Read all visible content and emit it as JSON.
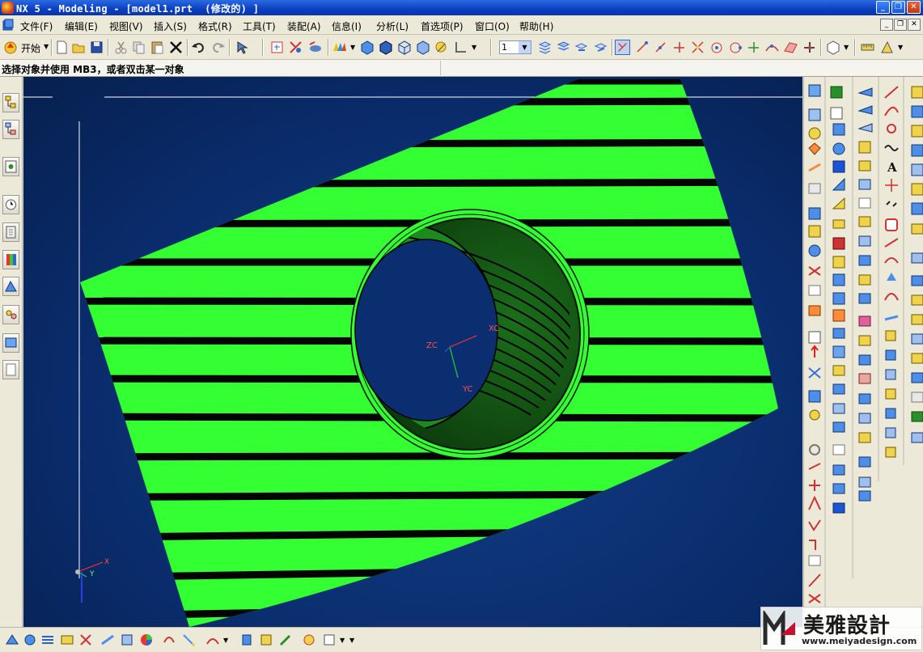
{
  "window": {
    "title": "NX 5 - Modeling - [model1.prt  (修改的) ]",
    "minimize_glyph": "_",
    "restore_glyph": "❐",
    "close_glyph": "✕"
  },
  "menubar": {
    "items": [
      "文件(F)",
      "编辑(E)",
      "视图(V)",
      "插入(S)",
      "格式(R)",
      "工具(T)",
      "装配(A)",
      "信息(I)",
      "分析(L)",
      "首选项(P)",
      "窗口(O)",
      "帮助(H)"
    ],
    "mdi_minimize": "_",
    "mdi_restore": "❐",
    "mdi_close": "✕"
  },
  "toolbar": {
    "start_label": "开始",
    "layer_value": "1"
  },
  "cue_line": {
    "text": "选择对象并使用 MB3，或者双击某一对象"
  },
  "viewport": {
    "wcs_labels": {
      "zc": "ZC",
      "xc": "XC",
      "yc": "YC"
    },
    "absolute_triad_labels": {
      "x": "X",
      "y": "Y"
    },
    "colors": {
      "background": "#0a2c6c",
      "surface": "#33ff33",
      "stripe": "#050505"
    }
  },
  "watermark": {
    "brand": "美雅設計",
    "url": "www.meiyadesign.com"
  },
  "icons": {
    "app": "nx-app-icon",
    "start": "start-icon",
    "new": "new-file-icon",
    "open": "open-file-icon",
    "save": "save-icon",
    "cut": "cut-icon",
    "copy": "copy-icon",
    "paste": "paste-icon",
    "delete": "delete-icon",
    "undo": "undo-icon",
    "redo": "redo-icon"
  }
}
